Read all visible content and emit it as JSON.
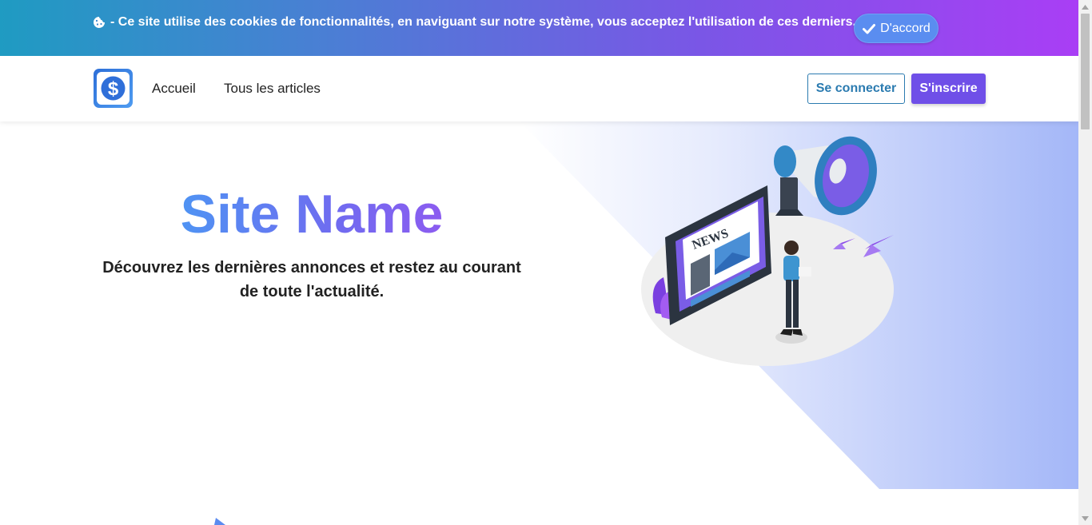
{
  "cookie_banner": {
    "icon": "cookie-icon",
    "text": "- Ce site utilise des cookies de fonctionnalités, en naviguant sur notre système, vous acceptez l'utilisation de ces derniers.",
    "accept_label": "D'accord",
    "accept_icon": "check-icon",
    "gradient": [
      "#1f9bc2",
      "#a93ef5"
    ]
  },
  "navbar": {
    "logo_icon": "dollar-logo-icon",
    "links": [
      {
        "label": "Accueil"
      },
      {
        "label": "Tous les articles"
      }
    ],
    "login_label": "Se connecter",
    "register_label": "S'inscrire",
    "login_color": "#2b7bb0",
    "register_color": "#6f4fe8"
  },
  "hero": {
    "title": "Site Name",
    "subtitle": "Découvrez les dernières annonces et restez au courant de toute l'actualité.",
    "illustration_label": "NEWS",
    "illustration_icon": "news-megaphone-illustration",
    "title_gradient": [
      "#3da9f5",
      "#a24ff0"
    ]
  }
}
